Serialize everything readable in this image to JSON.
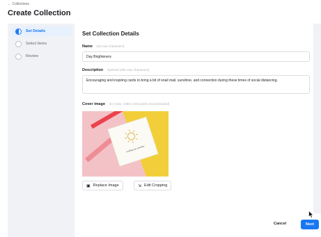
{
  "header": {
    "back_link": "← Collections",
    "title": "Create Collection"
  },
  "steps": [
    {
      "label": "Set Details",
      "state": "active"
    },
    {
      "label": "Select Items",
      "state": "pending"
    },
    {
      "label": "Review",
      "state": "pending"
    }
  ],
  "form": {
    "section_title": "Set Collection Details",
    "name": {
      "label": "Name",
      "hint": "(33 max characters)",
      "value": "Day Brighteners"
    },
    "description": {
      "label": "Description",
      "hint": "Optional (300 max characters)",
      "value": "Encouraging and inspiring cards to bring a bit of snail mail, sunshine, and connection during these times of social distancing."
    },
    "cover_image": {
      "label": "Cover image",
      "hint": "(4:3 ratio, 1080 x 810 pixels recommended)",
      "card_text": "sending you sunshine"
    },
    "replace_image_label": "Replace Image",
    "edit_cropping_label": "Edit Cropping"
  },
  "footer": {
    "cancel_label": "Cancel",
    "next_label": "Next"
  },
  "colors": {
    "accent": "#1877f2",
    "background": "#f0f2f5"
  },
  "icons": {
    "replace_image": "image-icon",
    "edit_cropping": "crop-icon",
    "cursor": "mouse-pointer-icon"
  }
}
